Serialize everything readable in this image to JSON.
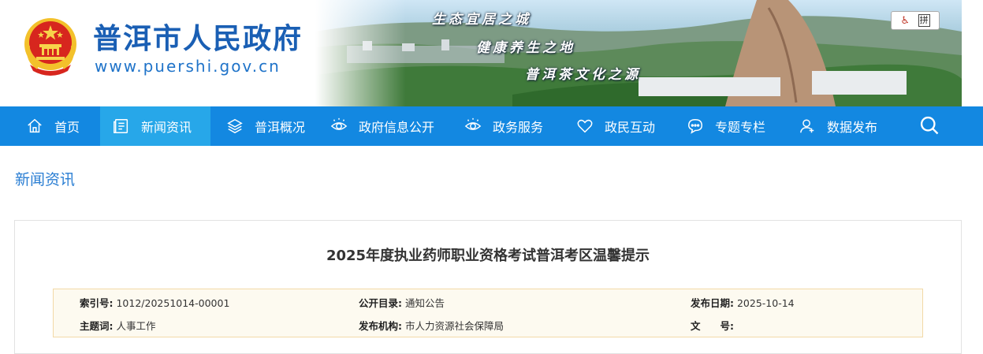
{
  "header": {
    "title": "普洱市人民政府",
    "url": "www.puershi.gov.cn",
    "slogans": [
      "生态宜居之城",
      "健康养生之地",
      "普洱茶文化之源"
    ],
    "tools": {
      "accessibility": "♿",
      "pinyin": "拼"
    },
    "colors": {
      "title": "#1a5fb4",
      "nav": "#1388e1",
      "nav_active": "#27a7e9"
    }
  },
  "nav": {
    "items": [
      {
        "label": "首页",
        "icon": "home-icon"
      },
      {
        "label": "新闻资讯",
        "icon": "news-icon",
        "active": true
      },
      {
        "label": "普洱概况",
        "icon": "layers-icon"
      },
      {
        "label": "政府信息公开",
        "icon": "eye-icon"
      },
      {
        "label": "政务服务",
        "icon": "eye-icon"
      },
      {
        "label": "政民互动",
        "icon": "heart-icon"
      },
      {
        "label": "专题专栏",
        "icon": "chat-icon"
      },
      {
        "label": "数据发布",
        "icon": "user-icon"
      }
    ],
    "search_icon": "search-icon"
  },
  "breadcrumb": "新闻资讯",
  "article": {
    "title": "2025年度执业药师职业资格考试普洱考区温馨提示",
    "meta": {
      "index_label": "索引号:",
      "index_value": "1012/20251014-00001",
      "catalog_label": "公开目录:",
      "catalog_value": "通知公告",
      "date_label": "发布日期:",
      "date_value": "2025-10-14",
      "subject_label": "主题词:",
      "subject_value": "人事工作",
      "org_label": "发布机构:",
      "org_value": "市人力资源社会保障局",
      "docno_label": "文　　号:",
      "docno_value": ""
    }
  }
}
